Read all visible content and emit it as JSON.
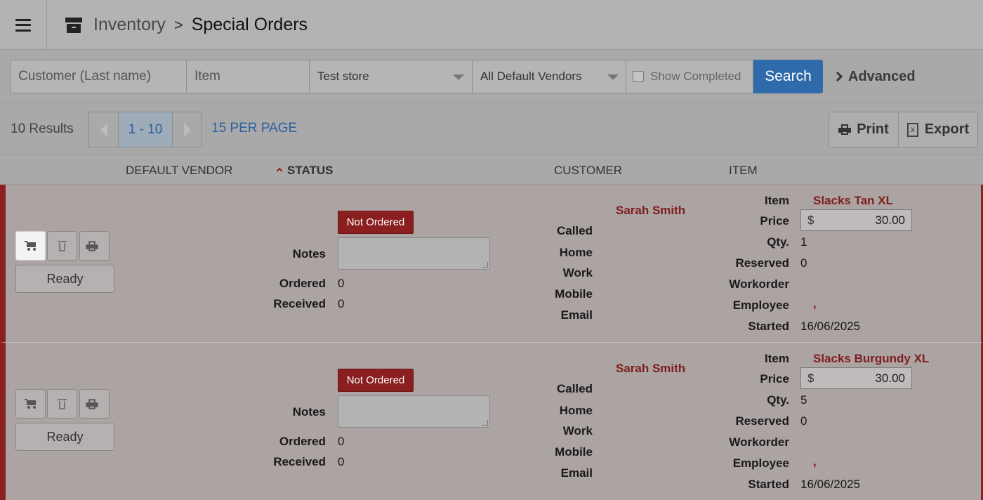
{
  "header": {
    "breadcrumb_parent": "Inventory",
    "breadcrumb_separator": ">",
    "breadcrumb_current": "Special Orders"
  },
  "filters": {
    "customer_placeholder": "Customer (Last name)",
    "item_placeholder": "Item",
    "store_selected": "Test store",
    "vendor_selected": "All Default Vendors",
    "show_completed_label": "Show Completed",
    "show_completed_checked": false,
    "search_label": "Search",
    "advanced_label": "Advanced"
  },
  "pager": {
    "results": "10 Results",
    "range": "1 - 10",
    "per_page": "15 PER PAGE",
    "print_label": "Print",
    "export_label": "Export"
  },
  "columns": {
    "default_vendor": "DEFAULT VENDOR",
    "status": "STATUS",
    "customer": "CUSTOMER",
    "item": "ITEM"
  },
  "labels": {
    "ready": "Ready",
    "notes": "Notes",
    "ordered": "Ordered",
    "received": "Received",
    "called": "Called",
    "home": "Home",
    "work": "Work",
    "mobile": "Mobile",
    "email": "Email",
    "item": "Item",
    "price": "Price",
    "qty": "Qty.",
    "reserved": "Reserved",
    "workorder": "Workorder",
    "employee": "Employee",
    "started": "Started",
    "currency": "$"
  },
  "orders": [
    {
      "status": "Not Ordered",
      "ordered": "0",
      "received": "0",
      "customer": "Sarah Smith",
      "item": "Slacks Tan XL",
      "price": "30.00",
      "qty": "1",
      "reserved": "0",
      "employee": ",",
      "started": "16/06/2025"
    },
    {
      "status": "Not Ordered",
      "ordered": "0",
      "received": "0",
      "customer": "Sarah Smith",
      "item": "Slacks Burgundy XL",
      "price": "30.00",
      "qty": "5",
      "reserved": "0",
      "employee": ",",
      "started": "16/06/2025"
    }
  ],
  "colors": {
    "accent_blue": "#2f6aaa",
    "status_red": "#8b1f1f",
    "row_bg": "#aca3a3"
  }
}
